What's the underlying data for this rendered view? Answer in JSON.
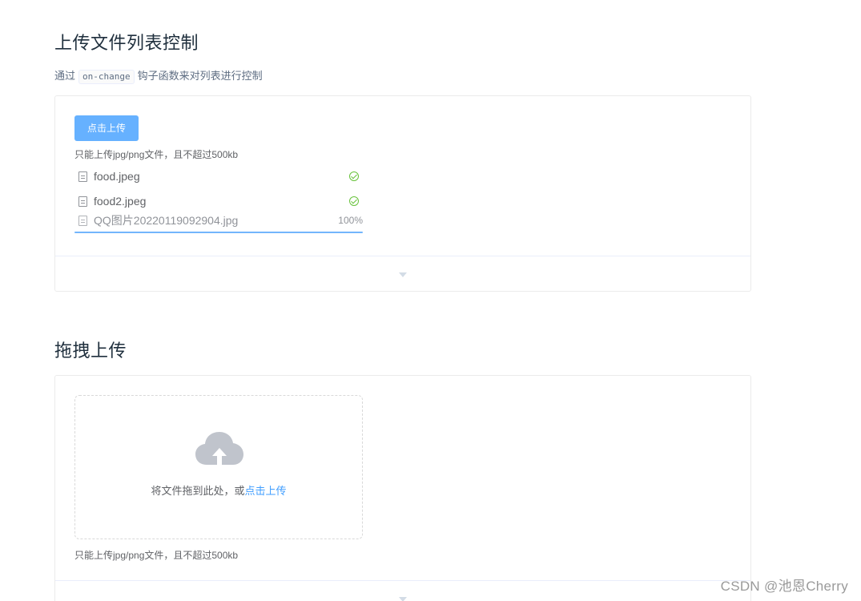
{
  "section1": {
    "title": "上传文件列表控制",
    "desc_before": "通过",
    "desc_code": "on-change",
    "desc_after": "钩子函数来对列表进行控制",
    "upload_button": "点击上传",
    "tip": "只能上传jpg/png文件，且不超过500kb",
    "files": [
      {
        "name": "food.jpeg",
        "status": "success"
      },
      {
        "name": "food2.jpeg",
        "status": "success"
      },
      {
        "name": "QQ图片20220119092904.jpg",
        "status": "uploading",
        "percent_text": "100%",
        "progress": 1.0
      }
    ]
  },
  "section2": {
    "title": "拖拽上传",
    "drag_text": "将文件拖到此处，或",
    "drag_link": "点击上传",
    "tip": "只能上传jpg/png文件，且不超过500kb"
  },
  "watermark": "CSDN @池恩Cherry",
  "colors": {
    "primary": "#409eff",
    "button": "#66b1ff",
    "success": "#67c23a",
    "cloud": "#c0c4cc"
  },
  "icons": {
    "file": "document-icon",
    "success": "circle-check-icon",
    "toggle": "caret-bottom-icon",
    "drag": "upload-cloud-icon"
  }
}
